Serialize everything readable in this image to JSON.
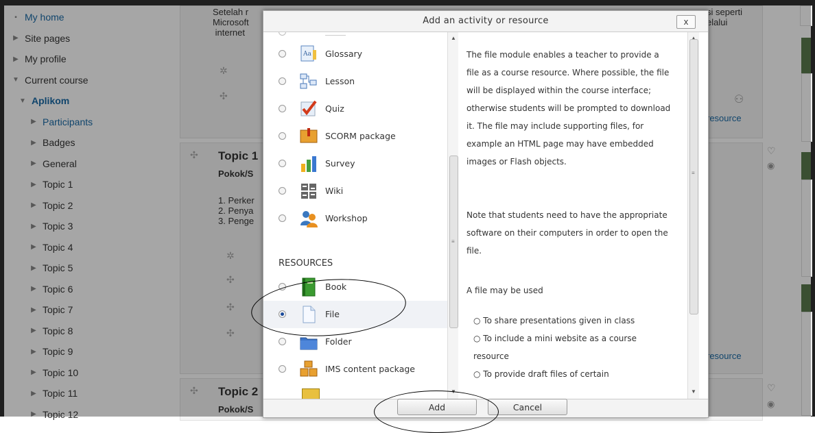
{
  "nav": {
    "items": [
      {
        "label": "My home",
        "style": "blue",
        "arrow": "▪"
      },
      {
        "label": "Site pages",
        "style": "",
        "arrow": "▶"
      },
      {
        "label": "My profile",
        "style": "",
        "arrow": "▶"
      },
      {
        "label": "Current course",
        "style": "",
        "arrow": "▼"
      },
      {
        "label": "Aplikom",
        "style": "bold",
        "arrow": "▼"
      },
      {
        "label": "Participants",
        "style": "blue",
        "arrow": "▶"
      },
      {
        "label": "Badges",
        "style": "",
        "arrow": "▶"
      },
      {
        "label": "General",
        "style": "",
        "arrow": "▶"
      },
      {
        "label": "Topic 1",
        "style": "",
        "arrow": "▶"
      },
      {
        "label": "Topic 2",
        "style": "",
        "arrow": "▶"
      },
      {
        "label": "Topic 3",
        "style": "",
        "arrow": "▶"
      },
      {
        "label": "Topic 4",
        "style": "",
        "arrow": "▶"
      },
      {
        "label": "Topic 5",
        "style": "",
        "arrow": "▶"
      },
      {
        "label": "Topic 6",
        "style": "",
        "arrow": "▶"
      },
      {
        "label": "Topic 7",
        "style": "",
        "arrow": "▶"
      },
      {
        "label": "Topic 8",
        "style": "",
        "arrow": "▶"
      },
      {
        "label": "Topic 9",
        "style": "",
        "arrow": "▶"
      },
      {
        "label": "Topic 10",
        "style": "",
        "arrow": "▶"
      },
      {
        "label": "Topic 11",
        "style": "",
        "arrow": "▶"
      },
      {
        "label": "Topic 12",
        "style": "",
        "arrow": "▶"
      }
    ]
  },
  "background": {
    "top_text_lines": "Setelah r\nMicrosoft\n internet",
    "right_top_text": "si seperti\nelalui",
    "topic1_title": "Topic 1",
    "topic1_sub": "Pokok/S",
    "topic1_items": "1. Perker\n2. Penya\n3. Penge",
    "topic2_title": "Topic 2",
    "topic2_sub": "Pokok/S",
    "resource_link_1": "resource",
    "resource_link_2": "resource"
  },
  "dialog": {
    "title": "Add an activity or resource",
    "close_label": "x",
    "section_resources": "RESOURCES",
    "options": [
      {
        "label": "Glossary",
        "icon": "glossary-icon",
        "selected": false
      },
      {
        "label": "Lesson",
        "icon": "lesson-icon",
        "selected": false
      },
      {
        "label": "Quiz",
        "icon": "quiz-icon",
        "selected": false
      },
      {
        "label": "SCORM package",
        "icon": "scorm-icon",
        "selected": false
      },
      {
        "label": "Survey",
        "icon": "survey-icon",
        "selected": false
      },
      {
        "label": "Wiki",
        "icon": "wiki-icon",
        "selected": false
      },
      {
        "label": "Workshop",
        "icon": "workshop-icon",
        "selected": false
      },
      {
        "label": "Book",
        "icon": "book-icon",
        "selected": false
      },
      {
        "label": "File",
        "icon": "file-icon",
        "selected": true
      },
      {
        "label": "Folder",
        "icon": "folder-icon",
        "selected": false
      },
      {
        "label": "IMS content package",
        "icon": "ims-package-icon",
        "selected": false
      }
    ],
    "description": {
      "p1": "The file module enables a teacher to provide a file as a course resource. Where possible, the file will be displayed within the course interface; otherwise students will be prompted to download it. The file may include supporting files, for example an HTML page may have embedded images or Flash objects.",
      "p2": "Note that students need to have the appropriate software on their computers in order to open the file.",
      "p3": "A file may be used",
      "li1": "To share presentations given in class",
      "li2": "To include a mini website as a course resource",
      "li3": "To provide draft files of certain"
    },
    "add_label": "Add",
    "cancel_label": "Cancel"
  },
  "colors": {
    "accent": "#1a6aa6",
    "block_header": "#5a7a4e"
  }
}
